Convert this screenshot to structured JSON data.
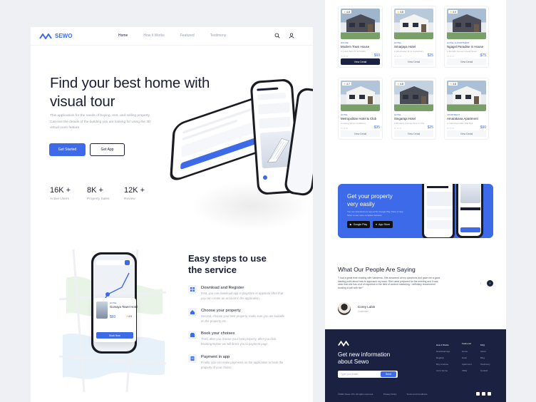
{
  "brand": {
    "name": "SEWO"
  },
  "nav": {
    "items": [
      "Home",
      "How it Works",
      "Featured",
      "Testimony"
    ],
    "active": "Home"
  },
  "hero": {
    "title": "Find your best home with visual tour",
    "description": "This applicatioin for the needs of buying, rent, and selling property. Can see the details of the building you are looking for using the 3D virtual room feature.",
    "primary_button": "Get Started",
    "secondary_button": "Get App"
  },
  "stats": [
    {
      "value": "16K +",
      "label": "Active Users"
    },
    {
      "value": "8K +",
      "label": "Property Sales"
    },
    {
      "value": "12K +",
      "label": "Review"
    }
  ],
  "map_card": {
    "type": "HOTEL",
    "name": "Gumaya Tower Hotel",
    "price": "$60",
    "rating": "4.9",
    "button": "Book Now"
  },
  "steps": {
    "title": "Easy steps to use the service",
    "items": [
      {
        "title": "Download and Register",
        "desc": "First, you can download app in playstore or appstore After that you can create an account in the application."
      },
      {
        "title": "Choose your property",
        "desc": "Second, choose your best property, make sure you are suitable on the property etc."
      },
      {
        "title": "Book your choises",
        "desc": "Third, after you choose your best property, after you click Booking Button we will direct you to payment page."
      },
      {
        "title": "Payment in app",
        "desc": "Finally, you can make payments on the application to book the property of your choice."
      }
    ]
  },
  "properties": [
    {
      "rating": "4.8",
      "type": "HOUSE",
      "name": "Modern Town House",
      "address": "Lubuk Batu St 12 Dublin",
      "price": "$60",
      "button": "View Detail",
      "active": true
    },
    {
      "rating": "4.8",
      "type": "HOTEL",
      "name": "Smarjaya Hotel",
      "address": "Winchester St 11 Canterbury",
      "price": "$25",
      "button": "View Detail",
      "active": false
    },
    {
      "rating": "4.9",
      "type": "HOTEL & APARTMENT",
      "name": "Ngagel Paradise in House",
      "address": "Bungah Avenue Lowell Street",
      "price": "$75",
      "button": "View Detail",
      "active": false
    },
    {
      "rating": "4.7",
      "type": "HOTEL",
      "name": "Metropolitan Hotel & Club",
      "address": "Lipang Street 14 Alberta",
      "price": "$35",
      "button": "View Detail",
      "active": false
    },
    {
      "rating": "4.8",
      "type": "HOTEL",
      "name": "Singaraja Hotel",
      "address": "Brisbane Avenue Pens 17 Pls",
      "price": "$25",
      "button": "View Detail",
      "active": false
    },
    {
      "rating": "4.8",
      "type": "APARTMENT",
      "name": "Amarakana Apartment",
      "address": "Calle Real Villa, Villa Bell",
      "price": "$90",
      "button": "View Detail",
      "active": false
    }
  ],
  "promo": {
    "title": "Get your property very easily",
    "desc": "You can download our app at the Google Play Store or App Store to use more complete features.",
    "google_play": "Google Play",
    "app_store": "App Store"
  },
  "testimonial": {
    "title": "What Our People Are Saying",
    "quote": "\"I had a great time chatting with Vandema. She answered all my questions and gave me a good starting point about how to approach my issue. She came prepared for the meeting and it was clear that she has a lot of expertise in the field of content marketing. I definitely recommend booking a call with her!\"",
    "name": "Corey Lubin",
    "role": "Customer"
  },
  "footer": {
    "title": "Get new information about Sewo",
    "input_placeholder": "Type your email",
    "submit": "Send",
    "columns": [
      {
        "heading": "How it Works",
        "links": [
          "Download App",
          "Register",
          "Buy a House",
          "List a Home"
        ]
      },
      {
        "heading": "Featu-red",
        "links": [
          "Home",
          "Hotel",
          "Apartment",
          "Villas"
        ]
      },
      {
        "heading": "FAQ",
        "links": [
          "About",
          "Blog",
          "Testimony",
          "Contact"
        ]
      }
    ],
    "copyright": "©2022 Sewo LTD. All rights reserved.",
    "privacy": "Privacy Policy",
    "terms": "Terms and Conditions"
  },
  "colors": {
    "accent": "#3d6ae8",
    "dark": "#1b2241",
    "text": "#1a1d33",
    "muted": "#9aa0ad"
  }
}
